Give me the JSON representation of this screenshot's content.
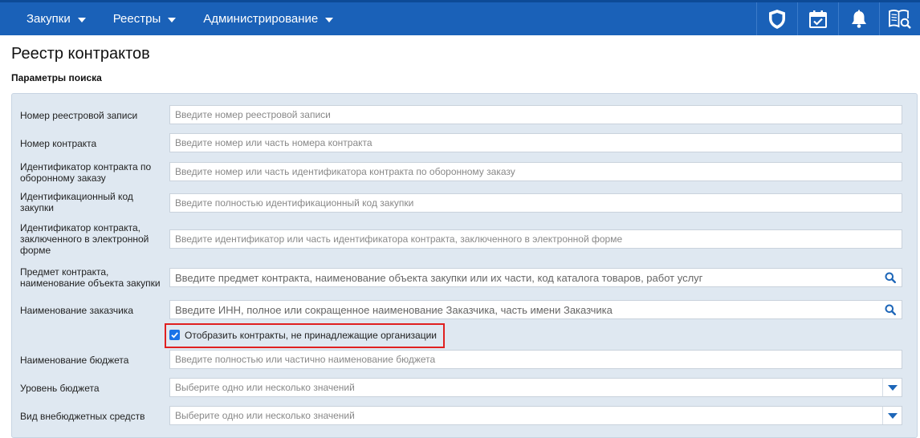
{
  "nav": {
    "items": [
      {
        "label": "Закупки"
      },
      {
        "label": "Реестры"
      },
      {
        "label": "Администрирование"
      }
    ],
    "icons": [
      "shield-icon",
      "calendar-check-icon",
      "bell-icon",
      "book-search-icon"
    ],
    "background": "#1a61b8"
  },
  "page": {
    "title": "Реестр контрактов",
    "section_title": "Параметры поиска"
  },
  "form": {
    "registry_number": {
      "label": "Номер реестровой записи",
      "placeholder": "Введите номер реестровой записи"
    },
    "contract_number": {
      "label": "Номер контракта",
      "placeholder": "Введите номер или часть номера контракта"
    },
    "defense_order_id": {
      "label": "Идентификатор контракта по оборонному заказу",
      "placeholder": "Введите номер или часть идентификатора контракта по оборонному заказу"
    },
    "purchase_code": {
      "label": "Идентификационный код закупки",
      "placeholder": "Введите полностью идентификационный код закупки"
    },
    "electronic_contract_id": {
      "label": "Идентификатор контракта, заключенного в электронной форме",
      "placeholder": "Введите идентификатор или часть идентификатора контракта, заключенного в электронной форме"
    },
    "contract_subject": {
      "label": "Предмет контракта, наименование объекта закупки",
      "placeholder": "Введите предмет контракта, наименование объекта закупки или их части, код каталога товаров, работ услуг"
    },
    "customer_name": {
      "label": "Наименование заказчика",
      "placeholder": "Введите ИНН, полное или сокращенное наименование Заказчика, часть имени Заказчика"
    },
    "show_foreign_contracts": {
      "label": "Отобразить контракты, не принадлежащие организации",
      "checked": true
    },
    "budget_name": {
      "label": "Наименование бюджета",
      "placeholder": "Введите полностью или частично наименование бюджета"
    },
    "budget_level": {
      "label": "Уровень бюджета",
      "placeholder": "Выберите одно или несколько значений"
    },
    "extra_budget_funds": {
      "label": "Вид внебюджетных средств",
      "placeholder": "Выберите одно или несколько значений"
    }
  }
}
